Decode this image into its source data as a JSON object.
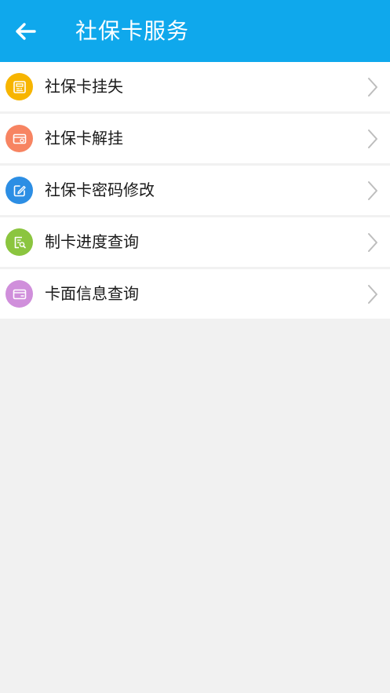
{
  "header": {
    "title": "社保卡服务",
    "back_icon": "arrow-left-icon",
    "background": "#0fa8ec"
  },
  "items": [
    {
      "label": "社保卡挂失",
      "icon": "card-report-icon",
      "color": "#f7b500"
    },
    {
      "label": "社保卡解挂",
      "icon": "card-unlock-icon",
      "color": "#f78462"
    },
    {
      "label": "社保卡密码修改",
      "icon": "edit-icon",
      "color": "#2c8ee4"
    },
    {
      "label": "制卡进度查询",
      "icon": "progress-search-icon",
      "color": "#8bc53f"
    },
    {
      "label": "卡面信息查询",
      "icon": "card-info-icon",
      "color": "#d08fdb"
    }
  ]
}
